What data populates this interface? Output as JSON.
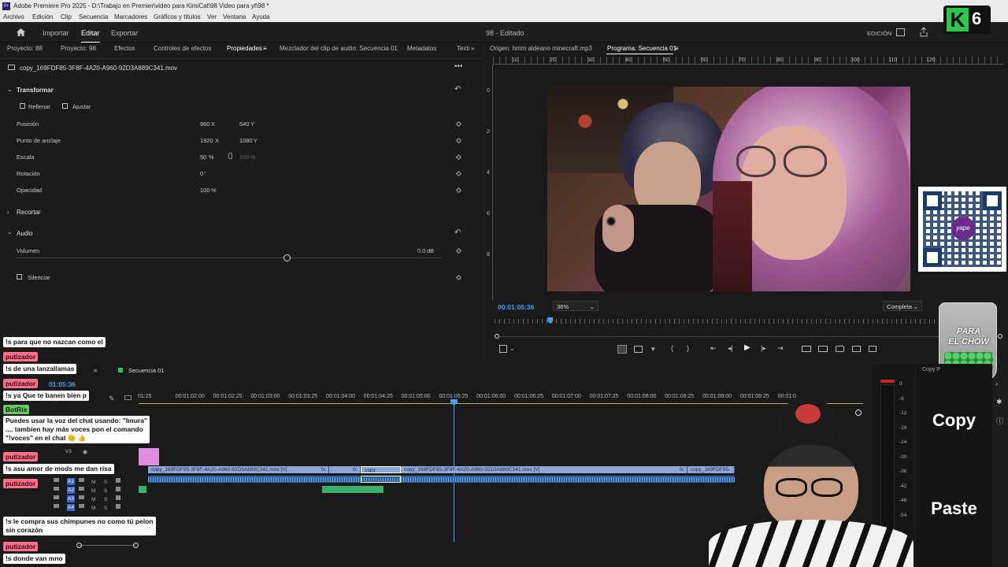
{
  "titlebar": {
    "logo": "Pr",
    "title": "Adobe Premiere Pro 2025 - D:\\Trabajo en Premier\\video para KimiCat\\98 Video para yt\\98 *"
  },
  "menu": [
    "Archivo",
    "Edición",
    "Clip",
    "Secuencia",
    "Marcadores",
    "Gráficos y títulos",
    "Ver",
    "Ventana",
    "Ayuda"
  ],
  "workspace": {
    "tabs": [
      "Importar",
      "Editar",
      "Exportar"
    ],
    "active_tab": "Editar",
    "project_title": "98 - Editado",
    "mode": "EDICIÓN"
  },
  "left_panel": {
    "tabs": [
      "Proyecto: 88",
      "Proyecto: 98",
      "Efectos",
      "Controles de efectos",
      "Propiedades",
      "Mezclador del clip de audio: Secuencia 01",
      "Metadatos",
      "Texto"
    ],
    "clip_name": "copy_169FDF85-3F8F-4A20-A960-92D3A889C341.mov",
    "transform": {
      "header": "Transformar",
      "fill": "Rellenar",
      "fit": "Ajustar",
      "position": {
        "label": "Posición",
        "x": "960",
        "y": "540"
      },
      "anchor": {
        "label": "Punto de anclaje",
        "x": "1920",
        "y": "1080"
      },
      "scale": {
        "label": "Escala",
        "value": "50",
        "linked": "100"
      },
      "rotation": {
        "label": "Rotación",
        "value": "0"
      },
      "opacity": {
        "label": "Opacidad",
        "value": "100"
      },
      "x_suffix": "X",
      "y_suffix": "Y",
      "pct": "%",
      "deg": "°"
    },
    "crop": "Recortar",
    "audio": {
      "header": "Audio",
      "volume_label": "Volumen",
      "volume_value": "0.0",
      "db": "dB",
      "mute": "Silenciar"
    }
  },
  "monitor": {
    "source_tab": "Origen: hmm aldeano minecraft.mp3",
    "program_tab": "Programa: Secuencia 01",
    "ruler": [
      "10",
      "20",
      "30",
      "40",
      "50",
      "60",
      "70",
      "80",
      "90",
      "100",
      "110",
      "120"
    ],
    "vruler": [
      "0",
      "2",
      "4",
      "6",
      "8"
    ],
    "timecode": "00:01:05:36",
    "zoom": "36%",
    "quality": "Completa",
    "playhead_fraction": 0.12
  },
  "timeline": {
    "sequence_tab": "Secuencia 01",
    "timecode": "01:05:36",
    "ruler": [
      "01:25",
      "00:01:02:00",
      "00:01:02:25",
      "00:01:03:00",
      "00:01:03:25",
      "00:01:04:00",
      "00:01:04:25",
      "00:01:05:00",
      "00:01:05:25",
      "00:01:06:00",
      "00:01:06:25",
      "00:01:07:00",
      "00:01:07:25",
      "00:01:08:00",
      "00:01:08:25",
      "00:01:09:00",
      "00:01:09:25",
      "00:01:0"
    ],
    "tracks_v": [
      "V3",
      "V2",
      "V1"
    ],
    "tracks_a": [
      "A1",
      "A2",
      "A3",
      "A4"
    ],
    "clips": [
      "copy_169FDF85-3F8F-4A20-A960-92D3A889C341.mov [V]",
      "copy_",
      "copy_169FDF85-3F8F-4A20-A960-92D3A889C341.mov [V]",
      "copy_169FDF85-"
    ],
    "fx": "fx",
    "meter_scale": [
      "0",
      "-6",
      "-12",
      "-18",
      "-24",
      "-30",
      "-36",
      "-42",
      "-48",
      "-54"
    ]
  },
  "chat": [
    {
      "type": "msg",
      "text": "!s para que no nazcan como el"
    },
    {
      "type": "name",
      "text": "putizador"
    },
    {
      "type": "msg",
      "text": "!s de una lanzallamas"
    },
    {
      "type": "name",
      "text": "putizador"
    },
    {
      "type": "msg",
      "text": "!s ya Que te banen bien p"
    },
    {
      "type": "name-green",
      "text": "BotRix"
    },
    {
      "type": "msg",
      "text": "Puedes usar la voz del chat usando: \"Imura\"\n.... tambien hay más voces pon el comando\n\"!voces\" en el chat 😊 👍"
    },
    {
      "type": "name",
      "text": "putizador"
    },
    {
      "type": "msg",
      "text": "!s asu amor de mods me dan risa"
    },
    {
      "type": "name",
      "text": "putizador"
    },
    {
      "type": "msg",
      "text": "!s le compra sus chimpunes no como tú pelon\nsin corazón"
    },
    {
      "type": "name",
      "text": "putizador"
    },
    {
      "type": "msg",
      "text": "!s donde van mno"
    }
  ],
  "stream_overlay": {
    "badge_letter": "K",
    "badge_number": "6",
    "qr_caption": "yape",
    "jar_text": "PARA\nEL CHOW",
    "copy_label": "Copy",
    "paste_label": "Paste",
    "copy_small": "Copy P"
  },
  "colors": {
    "accent_blue": "#4b9cf0",
    "chat_name": "#ff6f8a",
    "bot_name": "#6cc46a",
    "badge_green": "#2cc84a"
  }
}
